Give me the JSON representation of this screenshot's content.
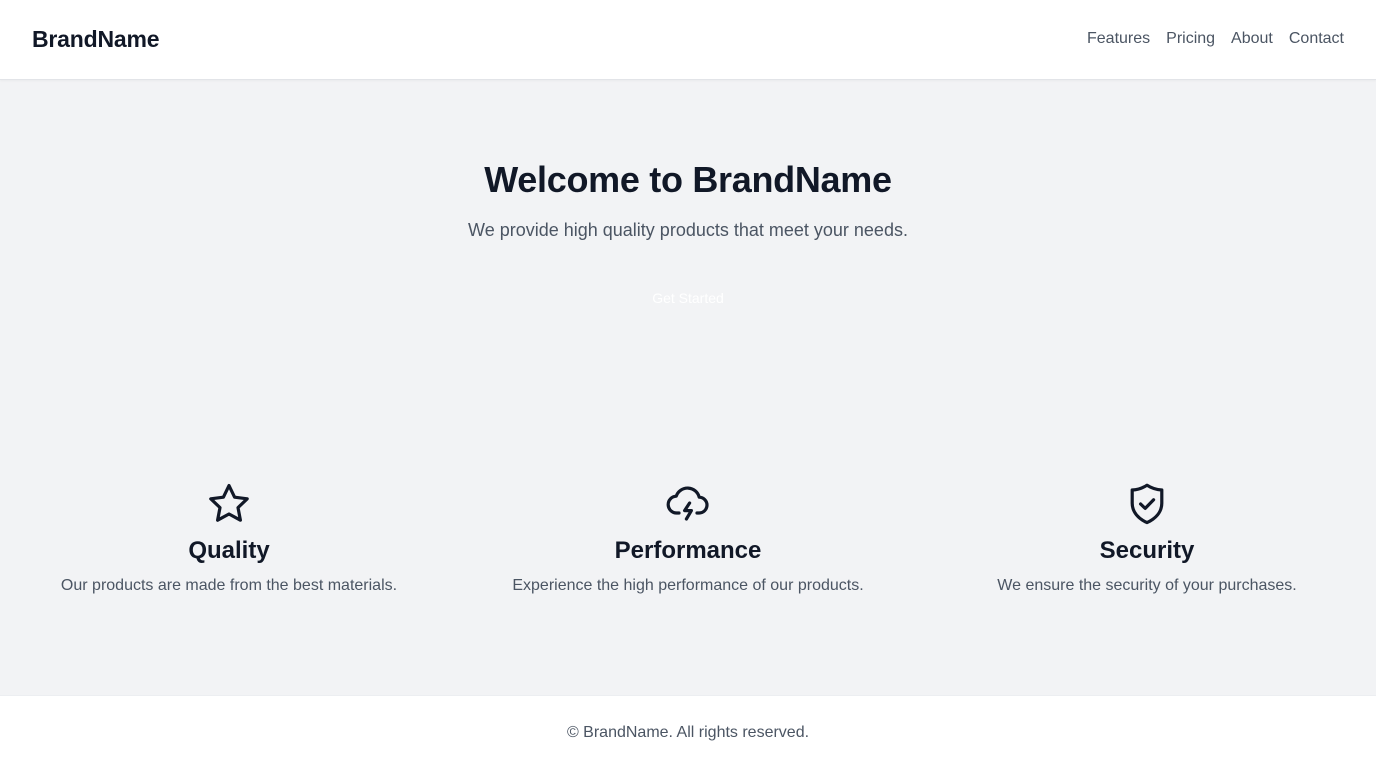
{
  "header": {
    "brand": "BrandName",
    "nav": [
      {
        "label": "Features"
      },
      {
        "label": "Pricing"
      },
      {
        "label": "About"
      },
      {
        "label": "Contact"
      }
    ]
  },
  "hero": {
    "title": "Welcome to BrandName",
    "subtitle": "We provide high quality products that meet your needs.",
    "cta_label": "Get Started"
  },
  "features": [
    {
      "icon": "star-icon",
      "title": "Quality",
      "description": "Our products are made from the best materials."
    },
    {
      "icon": "cloud-lightning-icon",
      "title": "Performance",
      "description": "Experience the high performance of our products."
    },
    {
      "icon": "shield-check-icon",
      "title": "Security",
      "description": "We ensure the security of your purchases."
    }
  ],
  "footer": {
    "text": "© BrandName. All rights reserved."
  },
  "colors": {
    "page_background": "#f2f3f5",
    "surface": "#ffffff",
    "text_primary": "#111827",
    "text_secondary": "#4b5563"
  }
}
